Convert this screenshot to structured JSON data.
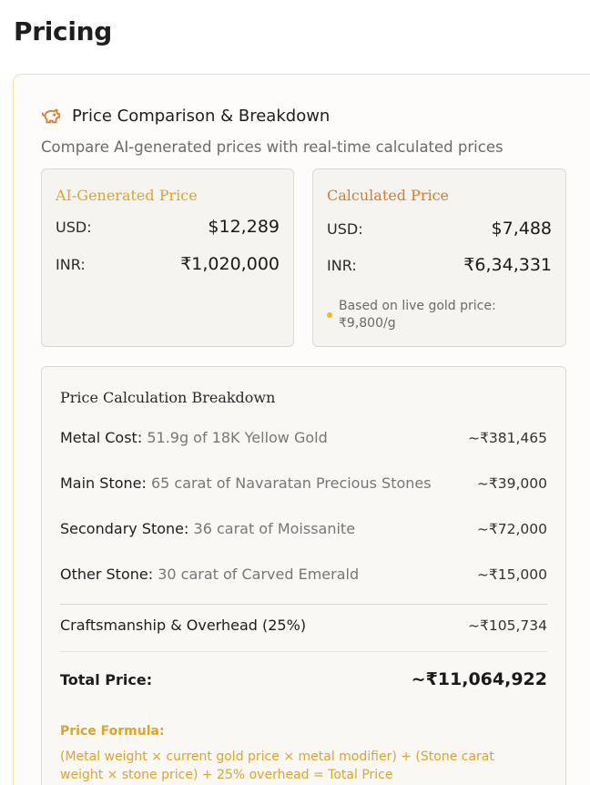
{
  "page": {
    "title": "Pricing"
  },
  "section": {
    "title": "Price Comparison & Breakdown",
    "subtitle": "Compare AI-generated prices with real-time calculated prices",
    "icon": "piggy-bank-icon",
    "accent_color": "#e07a2c"
  },
  "ai_card": {
    "title": "AI-Generated Price",
    "usd_label": "USD:",
    "usd_value": "$12,289",
    "inr_label": "INR:",
    "inr_value": "₹1,020,000",
    "title_color": "#e0a42a"
  },
  "calc_card": {
    "title": "Calculated Price",
    "usd_label": "USD:",
    "usd_value": "$7,488",
    "inr_label": "INR:",
    "inr_value": "₹6,34,331",
    "note": "Based on live gold price: ₹9,800/g",
    "title_color": "#d97c2b"
  },
  "breakdown": {
    "title": "Price Calculation Breakdown",
    "rows": [
      {
        "label": "Metal Cost:",
        "detail": "51.9g of 18K Yellow Gold",
        "amount": "~₹381,465"
      },
      {
        "label": "Main Stone:",
        "detail": "65 carat of Navaratan Precious Stones",
        "amount": "~₹39,000"
      },
      {
        "label": "Secondary Stone:",
        "detail": "36 carat of Moissanite",
        "amount": "~₹72,000"
      },
      {
        "label": "Other Stone:",
        "detail": "30 carat of Carved Emerald",
        "amount": "~₹15,000"
      }
    ],
    "overhead": {
      "label": "Craftsmanship & Overhead (25%)",
      "amount": "~₹105,734"
    },
    "total": {
      "label": "Total Price:",
      "amount": "~₹11,064,922"
    },
    "formula_title": "Price Formula:",
    "formula_text": "(Metal weight × current gold price × metal modifier) + (Stone carat weight × stone price) + 25% overhead = Total Price"
  }
}
